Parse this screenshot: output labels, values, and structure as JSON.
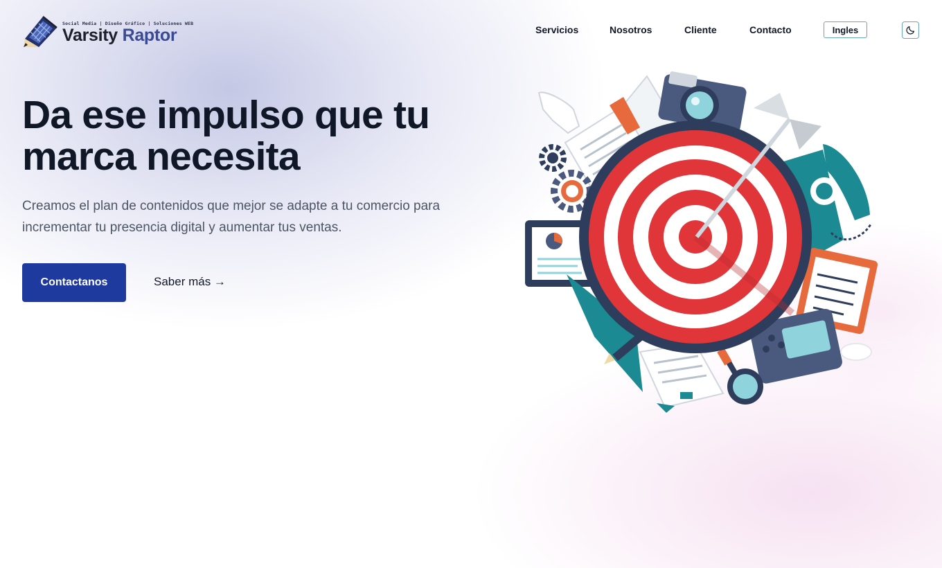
{
  "brand": {
    "tagline": "Social Media | Diseño Gráfico | Soluciones WEB",
    "name_part1": "Varsity",
    "name_part2": "Raptor",
    "logo_icon": "pencil-shield-logo"
  },
  "nav": {
    "items": [
      {
        "label": "Servicios"
      },
      {
        "label": "Nosotros"
      },
      {
        "label": "Cliente"
      },
      {
        "label": "Contacto"
      }
    ],
    "language_button": "Ingles",
    "theme_toggle_icon": "moon-icon"
  },
  "hero": {
    "title": "Da ese impulso que tu marca necesita",
    "subtitle": "Creamos el plan de contenidos que mejor se adapte a tu comercio para incrementar tu presencia digital y aumentar tus ventas.",
    "cta_primary": "Contactanos",
    "cta_secondary": "Saber más →",
    "illustration": "target-marketing-illustration"
  },
  "colors": {
    "primary": "#1e3a9f",
    "brand_accent": "#3a4a94",
    "outline": "#69a7b6",
    "target_red": "#e0363a",
    "teal": "#1c8a93"
  }
}
